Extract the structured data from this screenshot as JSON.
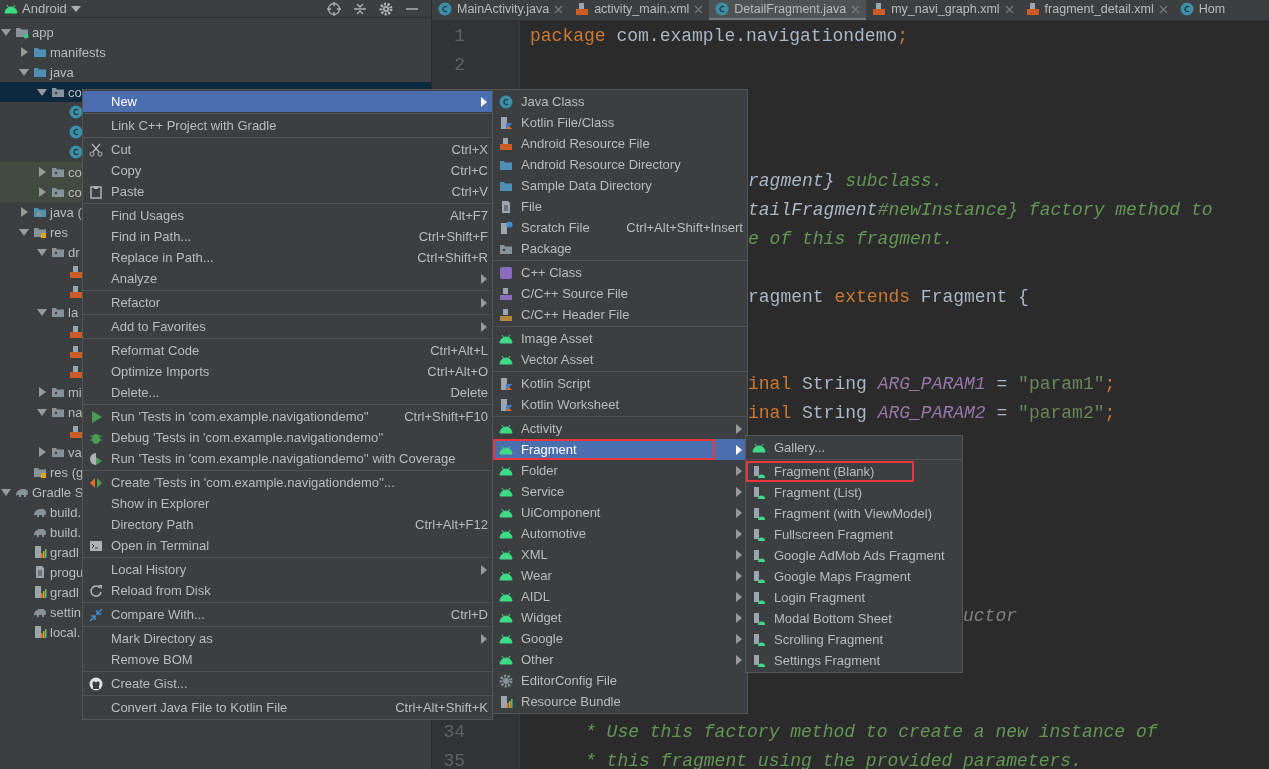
{
  "project_panel": {
    "title": "Android",
    "tree": [
      {
        "label": "app",
        "kind": "module",
        "expanded": true,
        "selected": false,
        "tinted": false,
        "children": [
          {
            "label": "manifests",
            "kind": "folder",
            "expanded": false,
            "selected": false,
            "tinted": false
          },
          {
            "label": "java",
            "kind": "folder",
            "expanded": true,
            "selected": false,
            "tinted": false,
            "children": [
              {
                "label": "co",
                "kind": "package",
                "expanded": true,
                "selected": true,
                "tinted": false,
                "children": [
                  {
                    "kind": "class",
                    "selected": false,
                    "tinted": false
                  },
                  {
                    "kind": "class",
                    "selected": false,
                    "tinted": false
                  },
                  {
                    "kind": "class",
                    "selected": false,
                    "tinted": false
                  }
                ]
              },
              {
                "label": "co",
                "kind": "package",
                "expanded": false,
                "selected": false,
                "tinted": true
              },
              {
                "label": "co",
                "kind": "package",
                "expanded": false,
                "selected": false,
                "tinted": true
              }
            ]
          },
          {
            "label": "java (",
            "kind": "generated",
            "expanded": false,
            "selected": false,
            "tinted": false
          },
          {
            "label": "res",
            "kind": "res",
            "expanded": true,
            "selected": false,
            "tinted": false,
            "children": [
              {
                "label": "dr",
                "kind": "package",
                "expanded": true,
                "selected": false,
                "tinted": false,
                "children": [
                  {
                    "kind": "xml",
                    "selected": false,
                    "tinted": false
                  },
                  {
                    "kind": "xml",
                    "selected": false,
                    "tinted": false
                  }
                ]
              },
              {
                "label": "la",
                "kind": "package",
                "expanded": true,
                "selected": false,
                "tinted": false,
                "children": [
                  {
                    "kind": "xml",
                    "selected": false,
                    "tinted": false
                  },
                  {
                    "kind": "xml",
                    "selected": false,
                    "tinted": false
                  },
                  {
                    "kind": "xml",
                    "selected": false,
                    "tinted": false
                  }
                ]
              },
              {
                "label": "mi",
                "kind": "package",
                "expanded": false,
                "selected": false,
                "tinted": false
              },
              {
                "label": "na",
                "kind": "package",
                "expanded": true,
                "selected": false,
                "tinted": false,
                "children": [
                  {
                    "kind": "xml",
                    "selected": false,
                    "tinted": false
                  }
                ]
              },
              {
                "label": "va",
                "kind": "package",
                "expanded": false,
                "selected": false,
                "tinted": false
              }
            ]
          },
          {
            "label": "res (g",
            "kind": "res",
            "selected": false,
            "tinted": false
          }
        ]
      },
      {
        "label": "Gradle S",
        "kind": "gradle",
        "expanded": true,
        "selected": false,
        "tinted": false,
        "children": [
          {
            "label": "build.",
            "kind": "gradle",
            "selected": false,
            "tinted": false
          },
          {
            "label": "build.",
            "kind": "gradle",
            "selected": false,
            "tinted": false
          },
          {
            "label": "gradl",
            "kind": "properties",
            "selected": false,
            "tinted": false
          },
          {
            "label": "progu",
            "kind": "file",
            "selected": false,
            "tinted": false
          },
          {
            "label": "gradl",
            "kind": "properties",
            "selected": false,
            "tinted": false
          },
          {
            "label": "settin",
            "kind": "gradle",
            "selected": false,
            "tinted": false
          },
          {
            "label": "local.",
            "kind": "properties",
            "selected": false,
            "tinted": false
          }
        ]
      }
    ]
  },
  "editor": {
    "tabs": [
      {
        "label": "MainActivity.java",
        "kind": "class",
        "selected": false,
        "closable": true
      },
      {
        "label": "activity_main.xml",
        "kind": "xml",
        "selected": false,
        "closable": true
      },
      {
        "label": "DetailFragment.java",
        "kind": "class",
        "selected": true,
        "closable": true
      },
      {
        "label": "my_navi_graph.xml",
        "kind": "xml",
        "selected": false,
        "closable": true
      },
      {
        "label": "fragment_detail.xml",
        "kind": "xml",
        "selected": false,
        "closable": true
      },
      {
        "label": "Hom",
        "kind": "class",
        "selected": false,
        "closable": false
      }
    ],
    "lines": [
      {
        "kind": "code",
        "number": "1",
        "tokens": [
          {
            "kind": "keyword",
            "text": "package"
          },
          {
            "kind": "plain",
            "text": " com.example.navigationdemo"
          },
          {
            "kind": "keyword",
            "text": ";"
          }
        ]
      },
      {
        "kind": "blank",
        "number": "2"
      },
      {
        "kind": "blank"
      },
      {
        "kind": "blank"
      },
      {
        "kind": "blank"
      },
      {
        "kind": "behind-submenu",
        "tokens": [
          {
            "kind": "docref",
            "text": "ragment}"
          },
          {
            "kind": "doc",
            "text": " subclass."
          }
        ]
      },
      {
        "kind": "behind-submenu",
        "tokens": [
          {
            "kind": "docref",
            "text": "tailFragment"
          },
          {
            "kind": "doc",
            "text": "#newInstance} factory method to"
          }
        ]
      },
      {
        "kind": "behind-submenu",
        "tokens": [
          {
            "kind": "doc",
            "text": "e of this fragment."
          }
        ]
      },
      {
        "kind": "blank"
      },
      {
        "kind": "behind-submenu",
        "tokens": [
          {
            "kind": "plain",
            "text": "ragment "
          },
          {
            "kind": "keyword",
            "text": "extends"
          },
          {
            "kind": "plain",
            "text": " Fragment {"
          }
        ]
      },
      {
        "kind": "blank"
      },
      {
        "kind": "blank"
      },
      {
        "kind": "behind-submenu",
        "tokens": [
          {
            "kind": "keyword",
            "text": "inal"
          },
          {
            "kind": "plain",
            "text": " String "
          },
          {
            "kind": "constant",
            "text": "ARG_PARAM1"
          },
          {
            "kind": "plain",
            "text": " = "
          },
          {
            "kind": "string",
            "text": "\"param1\""
          },
          {
            "kind": "keyword",
            "text": ";"
          }
        ]
      },
      {
        "kind": "behind-submenu",
        "tokens": [
          {
            "kind": "keyword",
            "text": "inal"
          },
          {
            "kind": "plain",
            "text": " String "
          },
          {
            "kind": "constant",
            "text": "ARG_PARAM2"
          },
          {
            "kind": "plain",
            "text": " = "
          },
          {
            "kind": "string",
            "text": "\"param2\""
          },
          {
            "kind": "keyword",
            "text": ";"
          }
        ]
      },
      {
        "kind": "blank"
      },
      {
        "kind": "blank"
      },
      {
        "kind": "blank"
      },
      {
        "kind": "blank"
      },
      {
        "kind": "blank"
      },
      {
        "kind": "blank"
      },
      {
        "kind": "behind-second-submenu",
        "tokens": [
          {
            "kind": "comment",
            "text": "uctor"
          }
        ]
      },
      {
        "kind": "blank"
      },
      {
        "kind": "blank"
      },
      {
        "kind": "blank"
      },
      {
        "kind": "doc",
        "number": "34",
        "tokens": [
          {
            "kind": "doc",
            "text": "* Use this factory method to create a new instance of"
          }
        ]
      },
      {
        "kind": "doc",
        "number": "35",
        "tokens": [
          {
            "kind": "doc",
            "text": "* this fragment using the provided parameters."
          }
        ]
      }
    ]
  },
  "context_menu": {
    "groups": [
      [
        {
          "label": "New",
          "selected": true,
          "submenu": true
        }
      ],
      [
        {
          "label": "Link C++ Project with Gradle",
          "selected": false
        }
      ],
      [
        {
          "label": "Cut",
          "kind": "cut",
          "shortcut": "Ctrl+X",
          "selected": false
        },
        {
          "label": "Copy",
          "shortcut": "Ctrl+C",
          "selected": false
        },
        {
          "label": "Paste",
          "kind": "paste",
          "shortcut": "Ctrl+V",
          "selected": false
        }
      ],
      [
        {
          "label": "Find Usages",
          "shortcut": "Alt+F7",
          "selected": false
        },
        {
          "label": "Find in Path...",
          "shortcut": "Ctrl+Shift+F",
          "selected": false
        },
        {
          "label": "Replace in Path...",
          "shortcut": "Ctrl+Shift+R",
          "selected": false
        },
        {
          "label": "Analyze",
          "submenu": true,
          "selected": false
        }
      ],
      [
        {
          "label": "Refactor",
          "submenu": true,
          "selected": false
        }
      ],
      [
        {
          "label": "Add to Favorites",
          "submenu": true,
          "selected": false
        }
      ],
      [
        {
          "label": "Reformat Code",
          "shortcut": "Ctrl+Alt+L",
          "selected": false
        },
        {
          "label": "Optimize Imports",
          "shortcut": "Ctrl+Alt+O",
          "selected": false
        },
        {
          "label": "Delete...",
          "shortcut": "Delete",
          "selected": false
        }
      ],
      [
        {
          "label": "Run 'Tests in 'com.example.navigationdemo''",
          "kind": "run",
          "shortcut": "Ctrl+Shift+F10",
          "selected": false
        },
        {
          "label": "Debug 'Tests in 'com.example.navigationdemo''",
          "kind": "debug",
          "selected": false
        },
        {
          "label": "Run 'Tests in 'com.example.navigationdemo'' with Coverage",
          "kind": "coverage",
          "selected": false
        }
      ],
      [
        {
          "label": "Create 'Tests in 'com.example.navigationdemo''...",
          "kind": "create-test",
          "selected": false
        },
        {
          "label": "Show in Explorer",
          "selected": false
        },
        {
          "label": "Directory Path",
          "shortcut": "Ctrl+Alt+F12",
          "selected": false
        },
        {
          "label": "Open in Terminal",
          "kind": "terminal",
          "selected": false
        }
      ],
      [
        {
          "label": "Local History",
          "submenu": true,
          "selected": false
        },
        {
          "label": "Reload from Disk",
          "kind": "reload",
          "selected": false
        }
      ],
      [
        {
          "label": "Compare With...",
          "kind": "compare",
          "shortcut": "Ctrl+D",
          "selected": false
        }
      ],
      [
        {
          "label": "Mark Directory as",
          "submenu": true,
          "selected": false
        },
        {
          "label": "Remove BOM",
          "selected": false
        }
      ],
      [
        {
          "label": "Create Gist...",
          "kind": "github",
          "selected": false
        }
      ],
      [
        {
          "label": "Convert Java File to Kotlin File",
          "shortcut": "Ctrl+Alt+Shift+K",
          "selected": false
        }
      ]
    ]
  },
  "new_submenu": {
    "groups": [
      [
        {
          "label": "Java Class",
          "kind": "class",
          "selected": false
        },
        {
          "label": "Kotlin File/Class",
          "kind": "kotlin",
          "selected": false
        },
        {
          "label": "Android Resource File",
          "kind": "xml",
          "selected": false
        },
        {
          "label": "Android Resource Directory",
          "kind": "folder",
          "selected": false
        },
        {
          "label": "Sample Data Directory",
          "kind": "folder",
          "selected": false
        },
        {
          "label": "File",
          "kind": "file",
          "selected": false
        },
        {
          "label": "Scratch File",
          "kind": "scratch",
          "shortcut": "Ctrl+Alt+Shift+Insert",
          "selected": false
        },
        {
          "label": "Package",
          "kind": "package",
          "selected": false
        }
      ],
      [
        {
          "label": "C++ Class",
          "kind": "cpp-class",
          "selected": false
        },
        {
          "label": "C/C++ Source File",
          "kind": "cpp-source",
          "selected": false
        },
        {
          "label": "C/C++ Header File",
          "kind": "cpp-header",
          "selected": false
        }
      ],
      [
        {
          "label": "Image Asset",
          "kind": "android",
          "selected": false
        },
        {
          "label": "Vector Asset",
          "kind": "android",
          "selected": false
        }
      ],
      [
        {
          "label": "Kotlin Script",
          "kind": "kotlin",
          "selected": false
        },
        {
          "label": "Kotlin Worksheet",
          "kind": "kotlin",
          "selected": false
        }
      ],
      [
        {
          "label": "Activity",
          "kind": "android",
          "submenu": true,
          "selected": false
        },
        {
          "label": "Fragment",
          "kind": "android",
          "submenu": true,
          "selected": true,
          "annotated": true
        },
        {
          "label": "Folder",
          "kind": "android",
          "submenu": true,
          "selected": false
        },
        {
          "label": "Service",
          "kind": "android",
          "submenu": true,
          "selected": false
        },
        {
          "label": "UiComponent",
          "kind": "android",
          "submenu": true,
          "selected": false
        },
        {
          "label": "Automotive",
          "kind": "android",
          "submenu": true,
          "selected": false
        },
        {
          "label": "XML",
          "kind": "android",
          "submenu": true,
          "selected": false
        },
        {
          "label": "Wear",
          "kind": "android",
          "submenu": true,
          "selected": false
        },
        {
          "label": "AIDL",
          "kind": "android",
          "submenu": true,
          "selected": false
        },
        {
          "label": "Widget",
          "kind": "android",
          "submenu": true,
          "selected": false
        },
        {
          "label": "Google",
          "kind": "android",
          "submenu": true,
          "selected": false
        },
        {
          "label": "Other",
          "kind": "android",
          "submenu": true,
          "selected": false
        },
        {
          "label": "EditorConfig File",
          "kind": "gear",
          "selected": false
        },
        {
          "label": "Resource Bundle",
          "kind": "properties",
          "selected": false
        }
      ]
    ]
  },
  "fragment_submenu": {
    "groups": [
      [
        {
          "label": "Gallery...",
          "kind": "android",
          "selected": false
        }
      ],
      [
        {
          "label": "Fragment (Blank)",
          "kind": "template",
          "selected": false,
          "annotated": true
        },
        {
          "label": "Fragment (List)",
          "kind": "template",
          "selected": false
        },
        {
          "label": "Fragment (with ViewModel)",
          "kind": "template",
          "selected": false
        },
        {
          "label": "Fullscreen Fragment",
          "kind": "template",
          "selected": false
        },
        {
          "label": "Google AdMob Ads Fragment",
          "kind": "template",
          "selected": false
        },
        {
          "label": "Google Maps Fragment",
          "kind": "template",
          "selected": false
        },
        {
          "label": "Login Fragment",
          "kind": "template",
          "selected": false
        },
        {
          "label": "Modal Bottom Sheet",
          "kind": "template",
          "selected": false
        },
        {
          "label": "Scrolling Fragment",
          "kind": "template",
          "selected": false
        },
        {
          "label": "Settings Fragment",
          "kind": "template",
          "selected": false
        }
      ]
    ]
  }
}
